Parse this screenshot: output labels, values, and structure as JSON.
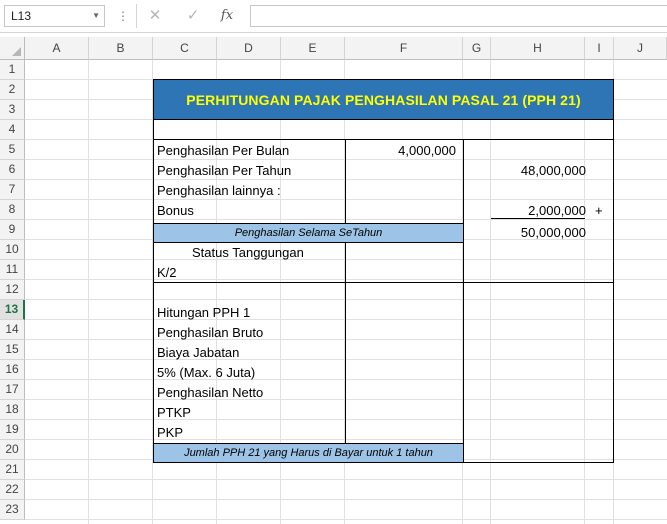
{
  "formula_bar": {
    "name_box": "L13",
    "name_box_dropdown_icon": "chevron-down-icon",
    "more_icon": "vertical-dots-icon",
    "cancel_icon": "x-icon",
    "confirm_icon": "check-icon",
    "fx_label": "fx",
    "formula": ""
  },
  "columns": [
    "A",
    "B",
    "C",
    "D",
    "E",
    "F",
    "G",
    "H",
    "I",
    "J"
  ],
  "rows": [
    "1",
    "2",
    "3",
    "4",
    "5",
    "6",
    "7",
    "8",
    "9",
    "10",
    "11",
    "12",
    "13",
    "14",
    "15",
    "16",
    "17",
    "18",
    "19",
    "20",
    "21",
    "22",
    "23"
  ],
  "selected_row": "13",
  "sheet": {
    "title": "PERHITUNGAN PAJAK PENGHASILAN PASAL 21 (PPH 21)",
    "penghasilan_per_bulan_label": "Penghasilan Per Bulan",
    "penghasilan_per_bulan_value": "4,000,000",
    "penghasilan_per_tahun_label": "Penghasilan Per Tahun",
    "penghasilan_per_tahun_value": "48,000,000",
    "penghasilan_lainnya_label": "Penghasilan lainnya :",
    "bonus_label": "Bonus",
    "bonus_value": "2,000,000",
    "plus_sign": "+",
    "selama_setahun_label": "Penghasilan Selama SeTahun",
    "selama_setahun_value": "50,000,000",
    "status_tanggungan_label": "Status Tanggungan",
    "status_value": "K/2",
    "hitungan_pph1_label": "Hitungan PPH 1",
    "penghasilan_bruto_label": "Penghasilan Bruto",
    "biaya_jabatan_label": "Biaya Jabatan",
    "biaya_jabatan_note": "5% (Max. 6 Juta)",
    "penghasilan_netto_label": "Penghasilan Netto",
    "ptkp_label": "PTKP",
    "pkp_label": "PKP",
    "jumlah_pph21_label": "Jumlah PPH 21 yang Harus di Bayar untuk 1 tahun"
  },
  "colors": {
    "title_fill": "#2e75b6",
    "title_text": "#ffff00",
    "band_fill": "#9dc3e6",
    "selected_row_accent": "#217346"
  }
}
